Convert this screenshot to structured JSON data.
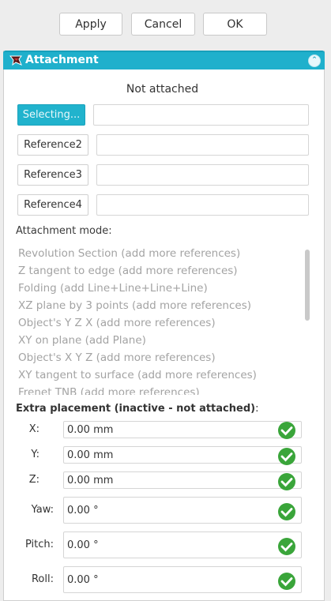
{
  "dialog_buttons": {
    "apply": "Apply",
    "cancel": "Cancel",
    "ok": "OK"
  },
  "panel": {
    "title": "Attachment"
  },
  "status": "Not attached",
  "references": [
    {
      "label": "Selecting...",
      "value": ""
    },
    {
      "label": "Reference2",
      "value": ""
    },
    {
      "label": "Reference3",
      "value": ""
    },
    {
      "label": "Reference4",
      "value": ""
    }
  ],
  "attachment_mode": {
    "label": "Attachment mode:",
    "items": [
      "Revolution Section (add more references)",
      "Z tangent to edge (add more references)",
      "Folding (add Line+Line+Line+Line)",
      "XZ plane by 3 points (add more references)",
      "Object's  Y Z X (add more references)",
      "XY on plane (add Plane)",
      "Object's  X Y Z (add more references)",
      "XY tangent to surface (add more references)",
      "Frenet TNB (add more references)"
    ]
  },
  "extra_placement": {
    "title": "Extra placement (inactive - not attached)",
    "suffix": ":",
    "fields": [
      {
        "label": "X:",
        "value": "0.00 mm"
      },
      {
        "label": "Y:",
        "value": "0.00 mm"
      },
      {
        "label": "Z:",
        "value": "0.00 mm"
      },
      {
        "label": "Yaw:",
        "value": "0.00 °"
      },
      {
        "label": "Pitch:",
        "value": "0.00 °"
      },
      {
        "label": "Roll:",
        "value": "0.00 °"
      }
    ]
  },
  "colors": {
    "accent": "#1fb0cc",
    "check": "#3aa53a"
  }
}
